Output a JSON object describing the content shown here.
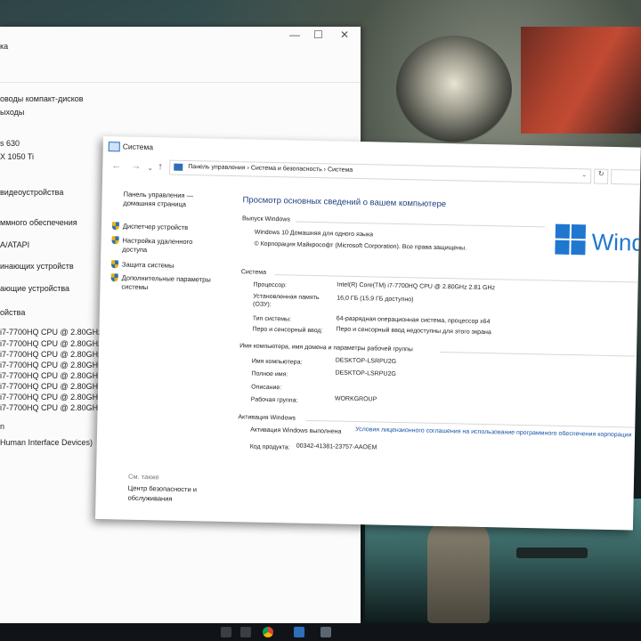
{
  "devmgr": {
    "title_fragment": "ка",
    "tree": [
      "оводы компакт-дисков",
      "ыходы",
      "s 630",
      "X 1050 Ti",
      "видеоустройства",
      "ммного обеспечения",
      "A/ATAPI",
      "инающих устройств",
      "ающие устройства",
      "ойства",
      "i7-7700HQ CPU @ 2.80GHz",
      "i7-7700HQ CPU @ 2.80GHz",
      "i7-7700HQ CPU @ 2.80GHz",
      "i7-7700HQ CPU @ 2.80GHz",
      "i7-7700HQ CPU @ 2.80GHz",
      "i7-7700HQ CPU @ 2.80GHz",
      "i7-7700HQ CPU @ 2.80GHz",
      "i7-7700HQ CPU @ 2.80GHz",
      "n",
      "Human Interface Devices)"
    ]
  },
  "window": {
    "title": "Система",
    "breadcrumb": "Панель управления  ›  Система и безопасность  ›  Система",
    "back": "←",
    "forward": "→",
    "up": "↑",
    "refresh": "↻",
    "dropdown": "⌄"
  },
  "left_pane": {
    "home": "Панель управления — домашняя страница",
    "items": [
      "Диспетчер устройств",
      "Настройка удаленного доступа",
      "Защита системы",
      "Дополнительные параметры системы"
    ],
    "see_also_label": "См. также",
    "see_also_link": "Центр безопасности и обслуживания"
  },
  "main": {
    "heading": "Просмотр основных сведений о вашем компьютере",
    "edition": {
      "section": "Выпуск Windows",
      "name": "Windows 10 Домашняя для одного языка",
      "copyright": "© Корпорация Майкрософт (Microsoft Corporation). Все права защищены.",
      "logo_text": "Windo"
    },
    "system": {
      "section": "Система",
      "processor_label": "Процессор:",
      "processor_value": "Intel(R) Core(TM) i7-7700HQ CPU @ 2.80GHz   2.81 GHz",
      "ram_label_1": "Установленная память",
      "ram_label_2": "(ОЗУ):",
      "ram_value": "16,0 ГБ (15,9 ГБ доступно)",
      "type_label": "Тип системы:",
      "type_value": "64-разрядная операционная система, процессор x64",
      "pen_label": "Перо и сенсорный ввод:",
      "pen_value": "Перо и сенсорный ввод недоступны для этого экрана"
    },
    "computer": {
      "section": "Имя компьютера, имя домена и параметры рабочей группы",
      "name_label": "Имя компьютера:",
      "name_value": "DESKTOP-LSRPU2G",
      "full_label": "Полное имя:",
      "full_value": "DESKTOP-LSRPU2G",
      "desc_label": "Описание:",
      "group_label": "Рабочая группа:",
      "group_value": "WORKGROUP"
    },
    "activation": {
      "section": "Активация Windows",
      "status": "Активация Windows выполнена",
      "license_link": "Условия лицензионного соглашения на использование программного обеспечения корпорации",
      "product_label": "Код продукта:",
      "product_value": "00342-41381-23757-AAOEM"
    }
  },
  "colors": {
    "accent": "#1f77d0",
    "link": "#1a56a8",
    "heading": "#1e3f80"
  }
}
